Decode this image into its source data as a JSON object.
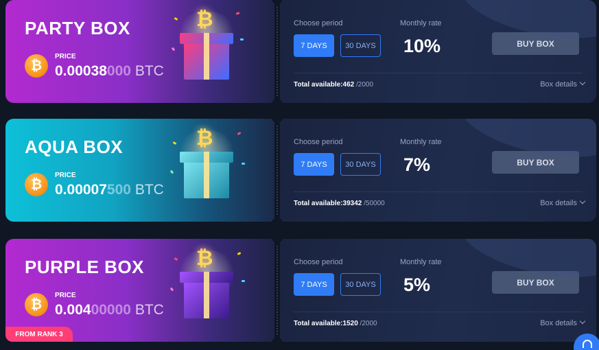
{
  "labels": {
    "price": "PRICE",
    "choose_period": "Choose period",
    "monthly_rate": "Monthly rate",
    "total_available": "Total available:",
    "box_details": "Box details",
    "buy_box": "BUY BOX",
    "period_7": "7 DAYS",
    "period_30": "30 DAYS",
    "btc_unit": "BTC"
  },
  "boxes": [
    {
      "name": "PARTY BOX",
      "price_main": "0.00038",
      "price_dim": "000",
      "rate": "10%",
      "available": "462",
      "capacity": "/2000",
      "theme": "party"
    },
    {
      "name": "AQUA BOX",
      "price_main": "0.00007",
      "price_dim": "500",
      "price_main2": "",
      "rate": "7%",
      "available": "39342",
      "capacity": "/50000",
      "theme": "aqua"
    },
    {
      "name": "PURPLE BOX",
      "price_main": "0.004",
      "price_dim": "00000",
      "rate": "5%",
      "available": "1520",
      "capacity": "/2000",
      "theme": "purple"
    }
  ],
  "rank_badge": "FROM RANK 3",
  "icons": {
    "coin": "bitcoin-icon",
    "gift": "gift-box-icon",
    "chevron": "chevron-down-icon",
    "support": "headset-icon"
  },
  "colors": {
    "accent": "#2f7cf6",
    "bitcoin": "#f7931a",
    "badge": "#ff3d77",
    "buy_button": "#475575"
  }
}
